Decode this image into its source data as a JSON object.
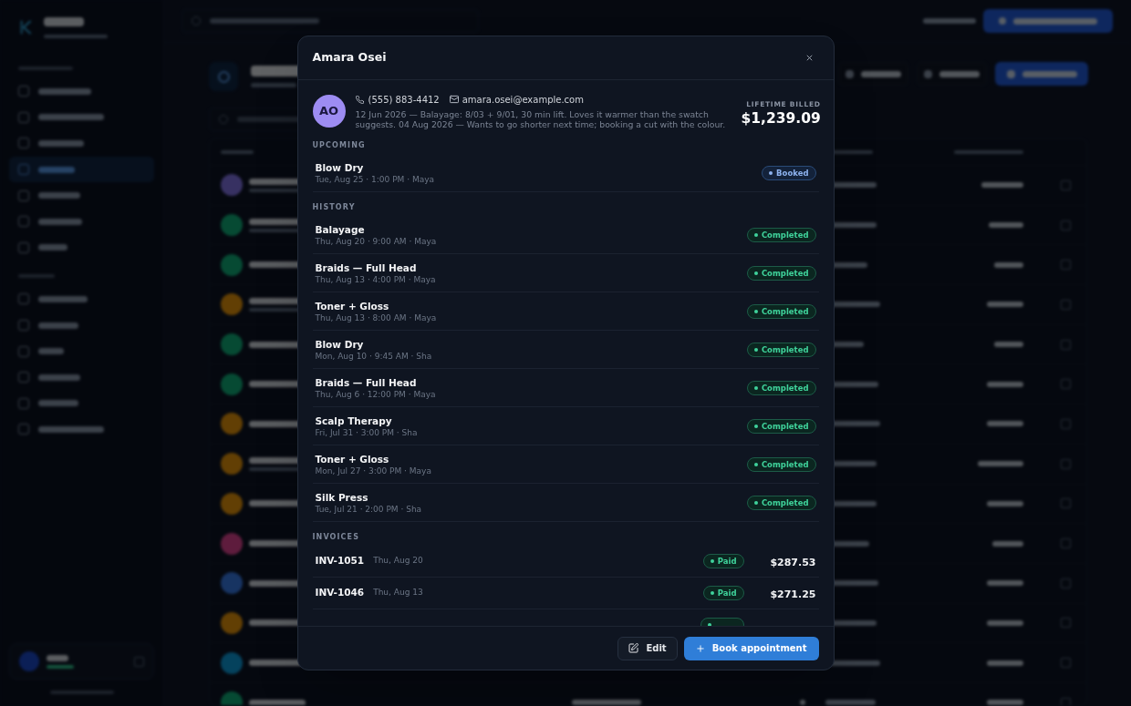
{
  "modal": {
    "title": "Amara Osei",
    "client": {
      "initials": "AO",
      "phone": "(555) 883-4412",
      "email": "amara.osei@example.com",
      "notes": "12 Jun 2026 — Balayage: 8/03 + 9/01, 30 min lift. Loves it warmer than the swatch suggests. 04 Aug 2026 — Wants to go shorter next time; booking a cut with the colour.",
      "lifetime_label": "LIFETIME BILLED",
      "lifetime_value": "$1,239.09"
    },
    "sections": [
      {
        "title": "UPCOMING",
        "kind": "appointments",
        "items": [
          {
            "service": "Blow Dry",
            "details": "Tue, Aug 25 · 1:00 PM · Maya",
            "status": {
              "label": "Booked",
              "kind": "booked"
            }
          }
        ]
      },
      {
        "title": "HISTORY",
        "kind": "appointments",
        "items": [
          {
            "service": "Balayage",
            "details": "Thu, Aug 20 · 9:00 AM · Maya",
            "status": {
              "label": "Completed",
              "kind": "completed"
            }
          },
          {
            "service": "Braids — Full Head",
            "details": "Thu, Aug 13 · 4:00 PM · Maya",
            "status": {
              "label": "Completed",
              "kind": "completed"
            }
          },
          {
            "service": "Toner + Gloss",
            "details": "Thu, Aug 13 · 8:00 AM · Maya",
            "status": {
              "label": "Completed",
              "kind": "completed"
            }
          },
          {
            "service": "Blow Dry",
            "details": "Mon, Aug 10 · 9:45 AM · Sha",
            "status": {
              "label": "Completed",
              "kind": "completed"
            }
          },
          {
            "service": "Braids — Full Head",
            "details": "Thu, Aug 6 · 12:00 PM · Maya",
            "status": {
              "label": "Completed",
              "kind": "completed"
            }
          },
          {
            "service": "Scalp Therapy",
            "details": "Fri, Jul 31 · 3:00 PM · Sha",
            "status": {
              "label": "Completed",
              "kind": "completed"
            }
          },
          {
            "service": "Toner + Gloss",
            "details": "Mon, Jul 27 · 3:00 PM · Maya",
            "status": {
              "label": "Completed",
              "kind": "completed"
            }
          },
          {
            "service": "Silk Press",
            "details": "Tue, Jul 21 · 2:00 PM · Sha",
            "status": {
              "label": "Completed",
              "kind": "completed"
            }
          }
        ]
      },
      {
        "title": "INVOICES",
        "kind": "invoices",
        "items": [
          {
            "number": "INV-1051",
            "date": "Thu, Aug 20",
            "status": {
              "label": "Paid",
              "kind": "paid"
            },
            "amount": "$287.53"
          },
          {
            "number": "INV-1046",
            "date": "Thu, Aug 13",
            "status": {
              "label": "Paid",
              "kind": "paid"
            },
            "amount": "$271.25"
          },
          {
            "status": {
              "kind": "paid"
            }
          }
        ]
      }
    ],
    "buttons": [
      {
        "label": "Edit",
        "kind": "secondary"
      },
      {
        "label": "Book appointment",
        "kind": "primary"
      }
    ]
  }
}
